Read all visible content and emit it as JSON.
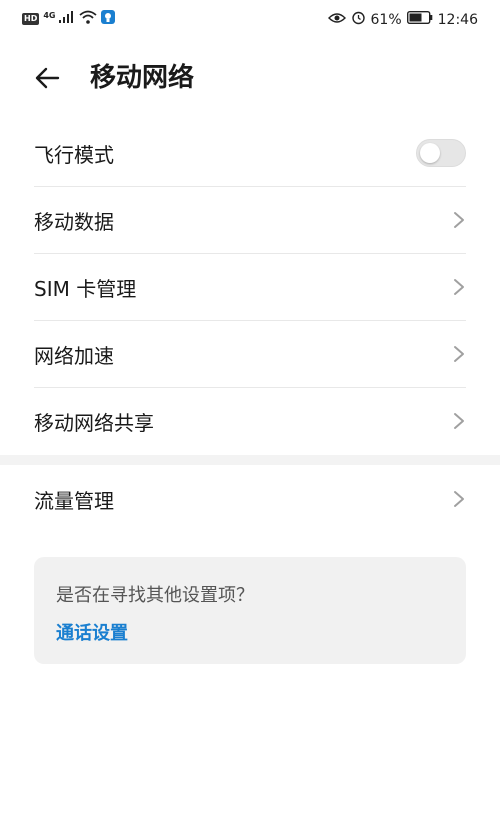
{
  "status_bar": {
    "hd": "HD",
    "network": "4G",
    "battery": "61%",
    "time": "12:46"
  },
  "header": {
    "title": "移动网络"
  },
  "settings": {
    "items": [
      {
        "label": "飞行模式",
        "control": "toggle",
        "state": "off"
      },
      {
        "label": "移动数据",
        "control": "chevron"
      },
      {
        "label": "SIM 卡管理",
        "control": "chevron"
      },
      {
        "label": "网络加速",
        "control": "chevron"
      },
      {
        "label": "移动网络共享",
        "control": "chevron"
      }
    ],
    "traffic": {
      "label": "流量管理",
      "control": "chevron"
    }
  },
  "suggestion": {
    "question": "是否在寻找其他设置项？",
    "link": "通话设置"
  },
  "colors": {
    "accent": "#1a7fd0",
    "toggle_off": "#e6e6e6"
  }
}
